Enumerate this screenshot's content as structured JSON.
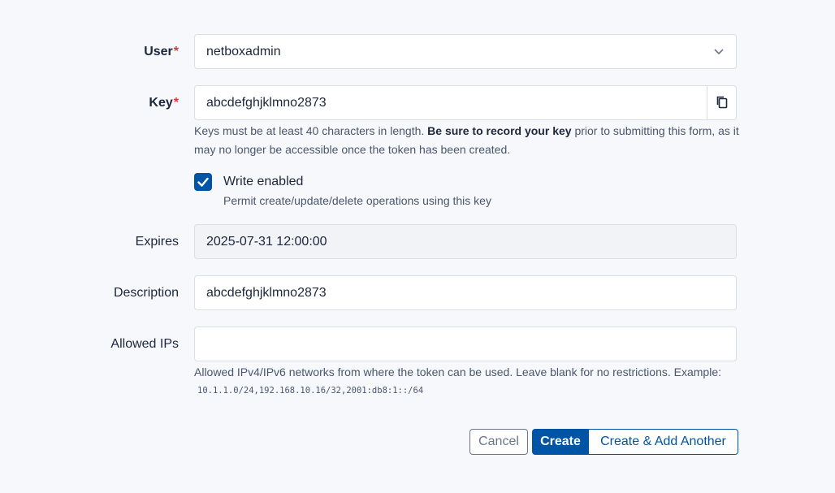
{
  "user": {
    "label": "User",
    "required_mark": "*",
    "value": "netboxadmin"
  },
  "key": {
    "label": "Key",
    "required_mark": "*",
    "value": "abcdefghjklmno2873",
    "help_part1": "Keys must be at least 40 characters in length. ",
    "help_bold": "Be sure to record your key",
    "help_part2": " prior to submitting this form, as it may no longer be accessible once the token has been created."
  },
  "write_enabled": {
    "label": "Write enabled",
    "checked": true,
    "help": "Permit create/update/delete operations using this key"
  },
  "expires": {
    "label": "Expires",
    "value": "2025-07-31 12:00:00"
  },
  "description": {
    "label": "Description",
    "value": "abcdefghjklmno2873"
  },
  "allowed_ips": {
    "label": "Allowed IPs",
    "value": "",
    "help": "Allowed IPv4/IPv6 networks from where the token can be used. Leave blank for no restrictions. Example:",
    "example": "10.1.1.0/24,192.168.10.16/32,2001:db8:1::/64"
  },
  "buttons": {
    "cancel": "Cancel",
    "create": "Create",
    "create_another": "Create & Add Another"
  },
  "colors": {
    "primary": "#0054a6",
    "required": "#d63939"
  }
}
